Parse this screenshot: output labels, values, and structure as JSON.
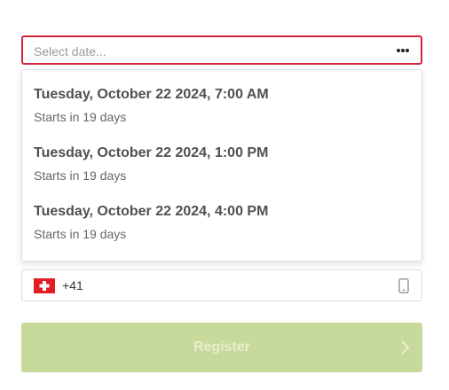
{
  "date_select": {
    "placeholder": "Select date...",
    "border_color": "#d6233c",
    "menu_icon": "more-horizontal-icon"
  },
  "date_options": [
    {
      "title": "Tuesday, October 22 2024, 7:00 AM",
      "subtitle": "Starts in 19 days"
    },
    {
      "title": "Tuesday, October 22 2024, 1:00 PM",
      "subtitle": "Starts in 19 days"
    },
    {
      "title": "Tuesday, October 22 2024, 4:00 PM",
      "subtitle": "Starts in 19 days"
    }
  ],
  "phone": {
    "country_flag": "switzerland-flag-icon",
    "dial_code": "+41",
    "type_icon": "mobile-phone-icon"
  },
  "register": {
    "label": "Register",
    "background_color": "#c8da9b",
    "icon": "chevron-right-icon"
  }
}
